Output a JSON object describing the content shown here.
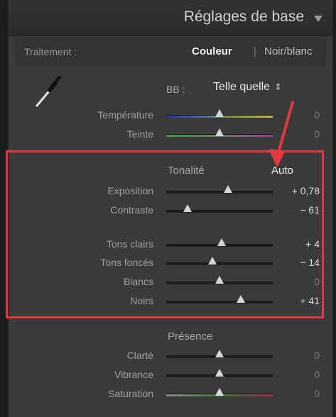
{
  "header": {
    "title": "Réglages de base"
  },
  "treatment": {
    "label": "Traitement :",
    "options": [
      "Couleur",
      "Noir/blanc"
    ],
    "separator": "|",
    "selected": "Couleur"
  },
  "wb": {
    "label": "BB :",
    "value": "Telle quelle",
    "stepper": "⇕"
  },
  "wb_sliders": [
    {
      "label": "Température",
      "value": "0",
      "position": 0.5
    },
    {
      "label": "Teinte",
      "value": "0",
      "position": 0.5
    }
  ],
  "tone": {
    "title": "Tonalité",
    "auto_label": "Auto",
    "sliders": [
      {
        "label": "Exposition",
        "value": "+ 0,78",
        "position": 0.58
      },
      {
        "label": "Contraste",
        "value": "− 61",
        "position": 0.2
      },
      {
        "label": "Tons clairs",
        "value": "+ 4",
        "position": 0.52
      },
      {
        "label": "Tons foncés",
        "value": "− 14",
        "position": 0.43
      },
      {
        "label": "Blancs",
        "value": "0",
        "position": 0.5
      },
      {
        "label": "Noirs",
        "value": "+ 41",
        "position": 0.7
      }
    ]
  },
  "presence": {
    "title": "Présence",
    "sliders": [
      {
        "label": "Clarté",
        "value": "0",
        "position": 0.5
      },
      {
        "label": "Vibrance",
        "value": "0",
        "position": 0.5
      },
      {
        "label": "Saturation",
        "value": "0",
        "position": 0.5
      }
    ]
  },
  "colors": {
    "highlight_box": "#e0393f",
    "panel_bg": "#3a3a3a"
  },
  "icons": {
    "dropper": "eyedropper-icon",
    "collapse": "triangle-down-icon"
  }
}
